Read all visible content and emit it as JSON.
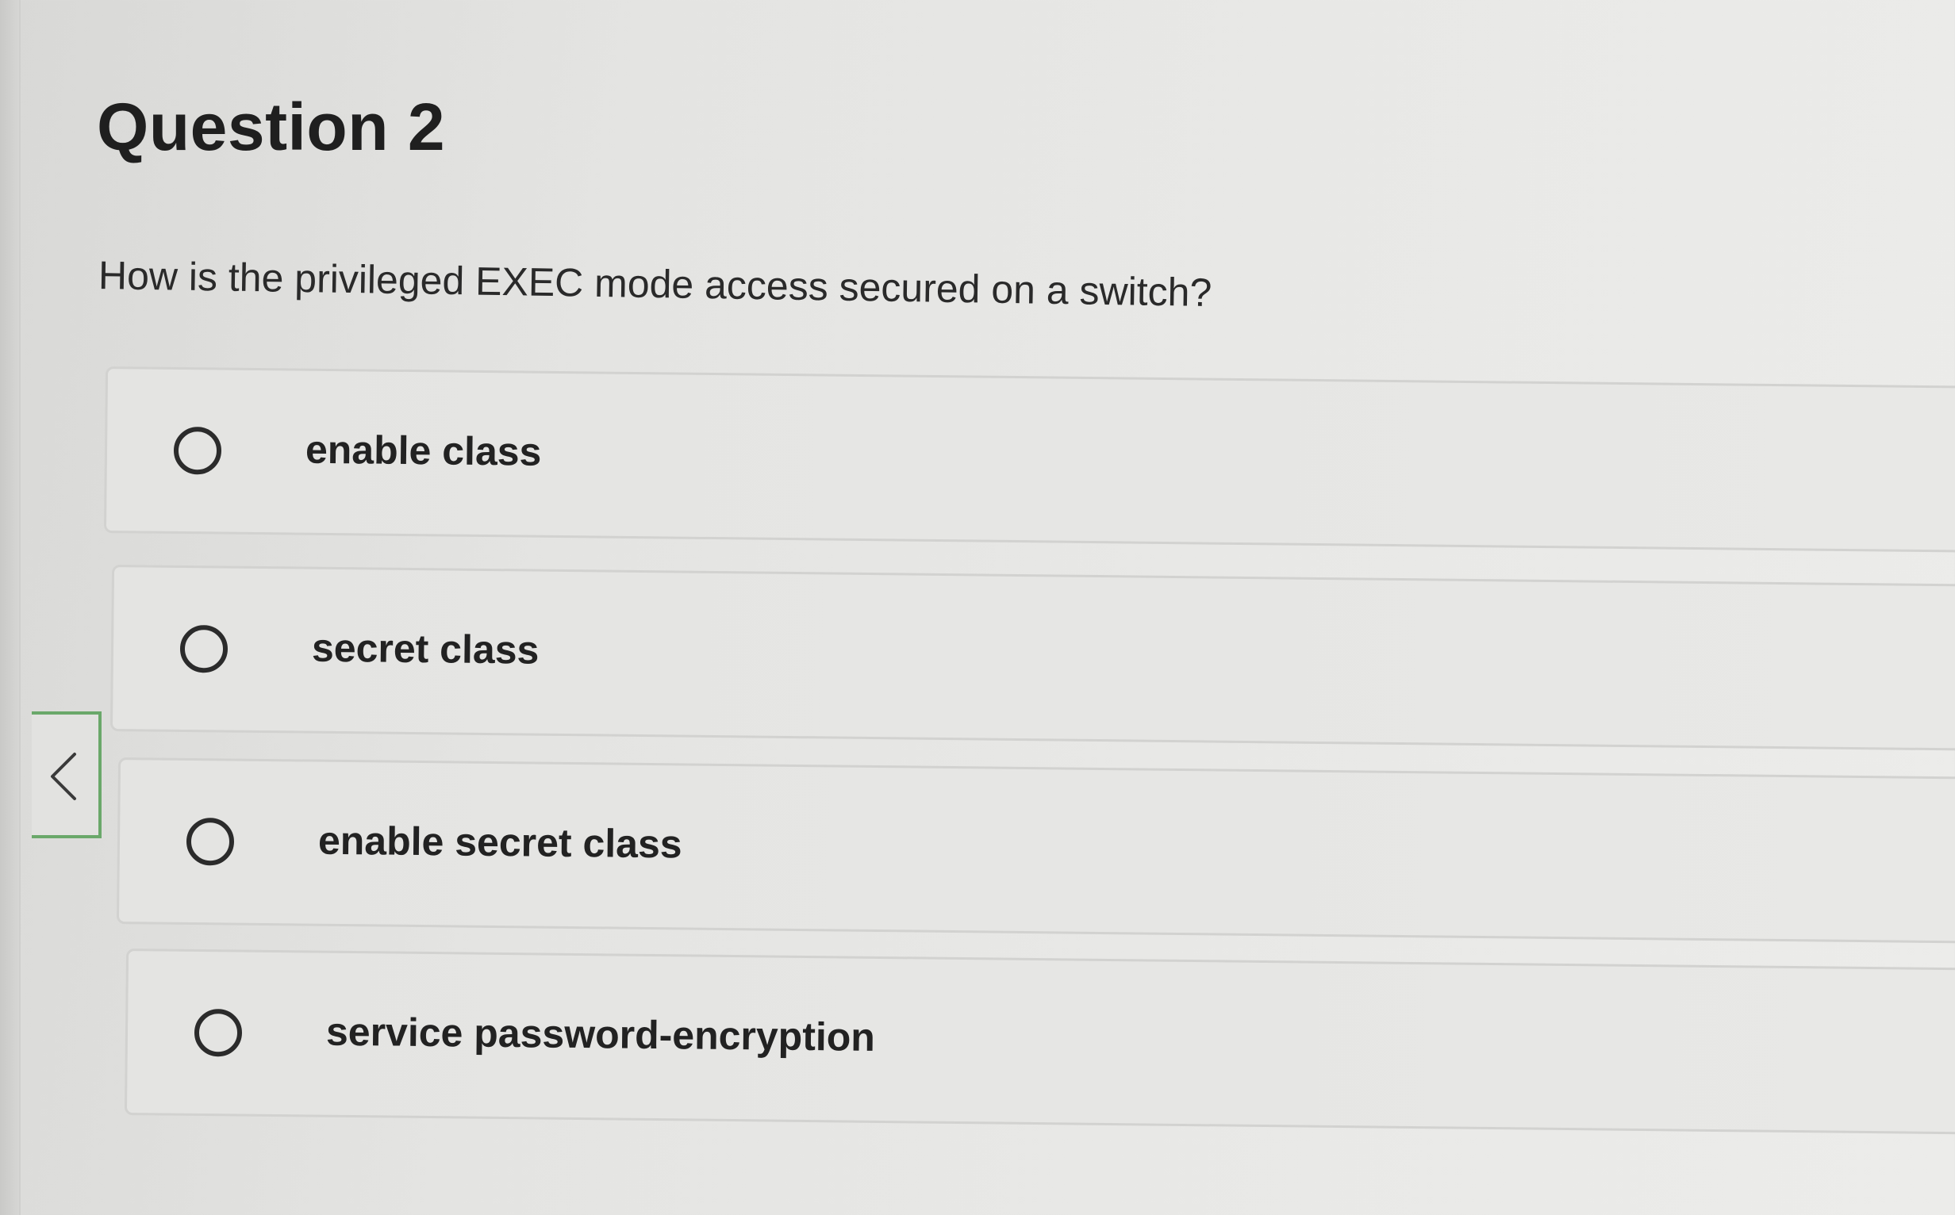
{
  "question": {
    "title": "Question 2",
    "prompt": "How is the privileged EXEC mode access secured on a switch?"
  },
  "answers": [
    {
      "label": "enable class",
      "selected": false
    },
    {
      "label": "secret class",
      "selected": false
    },
    {
      "label": "enable secret class",
      "selected": false
    },
    {
      "label": "service password-encryption",
      "selected": false
    }
  ],
  "nav": {
    "collapse_icon": "chevron-left-icon"
  },
  "colors": {
    "accent": "#6aa86a",
    "background": "#e6e6e4",
    "text": "#222222"
  }
}
